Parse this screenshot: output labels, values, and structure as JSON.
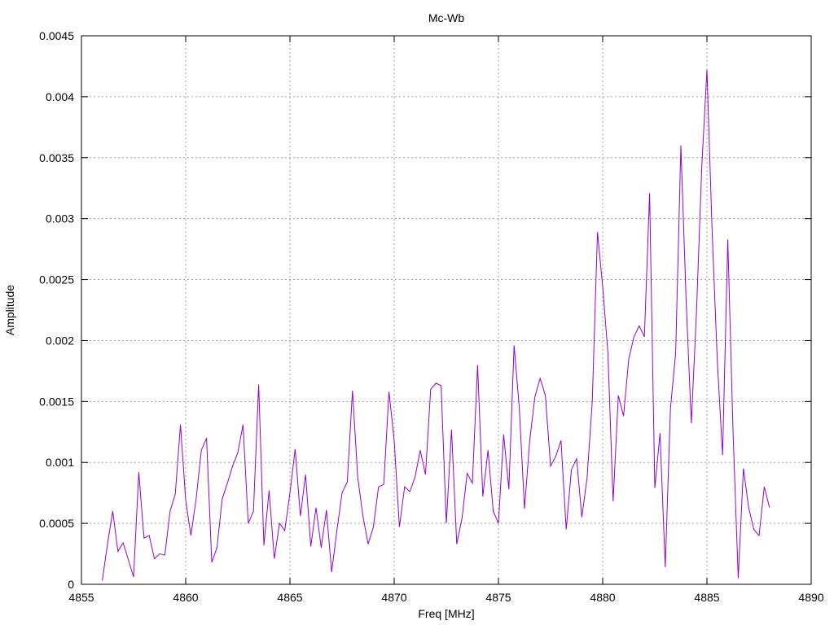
{
  "chart_data": {
    "type": "line",
    "title": "Mc-Wb",
    "xlabel": "Freq [MHz]",
    "ylabel": "Amplitude",
    "xlim": [
      4855,
      4890
    ],
    "ylim": [
      0,
      0.0045
    ],
    "xticks": [
      "4855",
      "4860",
      "4865",
      "4870",
      "4875",
      "4880",
      "4885",
      "4890"
    ],
    "yticks": [
      "0",
      "0.0005",
      "0.001",
      "0.0015",
      "0.002",
      "0.0025",
      "0.003",
      "0.0035",
      "0.004",
      "0.0045"
    ],
    "grid": true,
    "line_color": "#9400d3",
    "series": [
      {
        "x": [
          4856.0,
          4856.25,
          4856.5,
          4856.75,
          4857.0,
          4857.25,
          4857.5,
          4857.75,
          4858.0,
          4858.25,
          4858.5,
          4858.75,
          4859.0,
          4859.25,
          4859.5,
          4859.75,
          4860.0,
          4860.25,
          4860.5,
          4860.75,
          4861.0,
          4861.25,
          4861.5,
          4861.75,
          4862.0,
          4862.25,
          4862.5,
          4862.75,
          4863.0,
          4863.25,
          4863.5,
          4863.75,
          4864.0,
          4864.25,
          4864.5,
          4864.75,
          4865.0,
          4865.25,
          4865.5,
          4865.75,
          4866.0,
          4866.25,
          4866.5,
          4866.75,
          4867.0,
          4867.25,
          4867.5,
          4867.75,
          4868.0,
          4868.25,
          4868.5,
          4868.75,
          4869.0,
          4869.25,
          4869.5,
          4869.75,
          4870.0,
          4870.25,
          4870.5,
          4870.75,
          4871.0,
          4871.25,
          4871.5,
          4871.75,
          4872.0,
          4872.25,
          4872.5,
          4872.75,
          4873.0,
          4873.25,
          4873.5,
          4873.75,
          4874.0,
          4874.25,
          4874.5,
          4874.75,
          4875.0,
          4875.25,
          4875.5,
          4875.75,
          4876.0,
          4876.25,
          4876.5,
          4876.75,
          4877.0,
          4877.25,
          4877.5,
          4877.75,
          4878.0,
          4878.25,
          4878.5,
          4878.75,
          4879.0,
          4879.25,
          4879.5,
          4879.75,
          4880.0,
          4880.25,
          4880.5,
          4880.75,
          4881.0,
          4881.25,
          4881.5,
          4881.75,
          4882.0,
          4882.25,
          4882.5,
          4882.75,
          4883.0,
          4883.25,
          4883.5,
          4883.75,
          4884.0,
          4884.25,
          4884.5,
          4884.75,
          4885.0,
          4885.25,
          4885.5,
          4885.75,
          4886.0,
          4886.25,
          4886.5,
          4886.75,
          4887.0,
          4887.25,
          4887.5,
          4887.75,
          4888.0
        ],
        "y": [
          3e-05,
          0.00033,
          0.0006,
          0.00027,
          0.00034,
          0.0002,
          6e-05,
          0.00092,
          0.00038,
          0.0004,
          0.00021,
          0.00025,
          0.00024,
          0.0006,
          0.00074,
          0.00131,
          0.00069,
          0.0004,
          0.0007,
          0.0011,
          0.0012,
          0.00018,
          0.0003,
          0.0007,
          0.00083,
          0.00097,
          0.00108,
          0.00131,
          0.0005,
          0.0006,
          0.00164,
          0.00032,
          0.00077,
          0.00021,
          0.0005,
          0.00044,
          0.00075,
          0.00111,
          0.00056,
          0.0009,
          0.00031,
          0.00063,
          0.0003,
          0.00061,
          0.0001,
          0.00044,
          0.00075,
          0.00084,
          0.00159,
          0.00088,
          0.00056,
          0.00033,
          0.00047,
          0.0008,
          0.00082,
          0.00158,
          0.00118,
          0.00047,
          0.0008,
          0.00076,
          0.00088,
          0.0011,
          0.0009,
          0.0016,
          0.00165,
          0.00163,
          0.0005,
          0.00127,
          0.00033,
          0.00054,
          0.00091,
          0.00083,
          0.0018,
          0.00072,
          0.0011,
          0.0006,
          0.0005,
          0.00123,
          0.00078,
          0.00196,
          0.00145,
          0.00062,
          0.00118,
          0.00154,
          0.00169,
          0.00155,
          0.00097,
          0.00105,
          0.00118,
          0.00045,
          0.00094,
          0.00103,
          0.00055,
          0.00087,
          0.0015,
          0.00289,
          0.00244,
          0.0019,
          0.00068,
          0.00155,
          0.00138,
          0.00185,
          0.00203,
          0.00212,
          0.00203,
          0.00321,
          0.00079,
          0.00124,
          0.00014,
          0.00144,
          0.0019,
          0.0036,
          0.00234,
          0.00132,
          0.00224,
          0.00342,
          0.00422,
          0.00289,
          0.00182,
          0.00106,
          0.00283,
          0.00126,
          5e-05,
          0.00095,
          0.00063,
          0.00045,
          0.0004,
          0.0008,
          0.00063
        ]
      }
    ]
  }
}
